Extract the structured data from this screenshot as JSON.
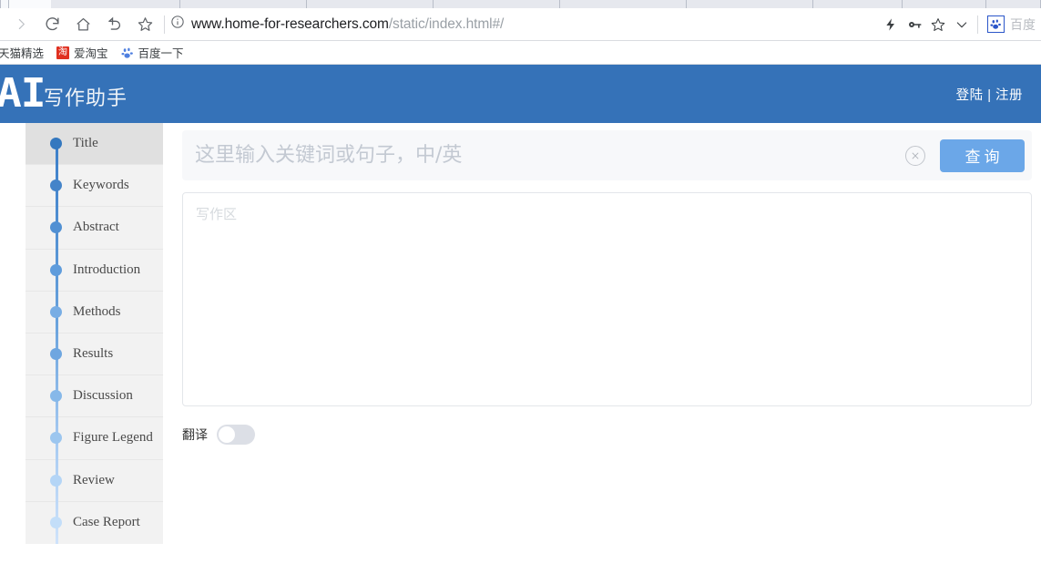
{
  "browser": {
    "nav_icons": [
      {
        "name": "forward-icon",
        "glyph": "forward"
      },
      {
        "name": "reload-icon",
        "glyph": "reload"
      },
      {
        "name": "home-icon",
        "glyph": "home"
      },
      {
        "name": "back-history-icon",
        "glyph": "undo"
      },
      {
        "name": "bookmark-star-icon",
        "glyph": "star"
      }
    ],
    "url": {
      "domain": "www.home-for-researchers.com",
      "path": "/static/index.html#/",
      "security_icon": "info-circle-icon"
    },
    "toolbar_right": [
      {
        "name": "lightning-icon",
        "glyph": "⚡"
      },
      {
        "name": "key-icon",
        "glyph": "key"
      },
      {
        "name": "star-outline-icon",
        "glyph": "star"
      },
      {
        "name": "chevron-down-icon",
        "glyph": "chevron"
      }
    ],
    "extension": {
      "name": "baidu-extension",
      "icon": "baidu-paw-icon",
      "label": "百度"
    },
    "bookmarks": [
      {
        "label": "天猫精选",
        "icon": "none"
      },
      {
        "label": "爱淘宝",
        "icon": "taobao-icon",
        "icon_glyph": "淘"
      },
      {
        "label": "百度一下",
        "icon": "baidu-paw-icon"
      }
    ],
    "tab_count": 11
  },
  "app_header": {
    "brand_mark": "AI",
    "brand_text": "写作助手",
    "auth": "登陆 | 注册",
    "bg_color": "#3572b8"
  },
  "sidebar": {
    "items": [
      {
        "label": "Title",
        "dot_color": "#3478bf",
        "active": true
      },
      {
        "label": "Keywords",
        "dot_color": "#4584c9",
        "active": false
      },
      {
        "label": "Abstract",
        "dot_color": "#5190d3",
        "active": false
      },
      {
        "label": "Introduction",
        "dot_color": "#5f9cdc",
        "active": false
      },
      {
        "label": "Methods",
        "dot_color": "#78ade4",
        "active": false
      },
      {
        "label": "Results",
        "dot_color": "#6ea6e0",
        "active": false
      },
      {
        "label": "Discussion",
        "dot_color": "#86b8e9",
        "active": false
      },
      {
        "label": "Figure Legend",
        "dot_color": "#9cc6ef",
        "active": false
      },
      {
        "label": "Review",
        "dot_color": "#b4d5f6",
        "active": false
      },
      {
        "label": "Case Report",
        "dot_color": "#c3def9",
        "active": false
      }
    ]
  },
  "main": {
    "search": {
      "value": "",
      "placeholder": "这里输入关键词或句子，中/英",
      "clear_icon": "clear-circle-icon",
      "button_label": "查询",
      "button_color": "#6ba7e8"
    },
    "editor": {
      "value": "",
      "placeholder": "写作区"
    },
    "translate": {
      "label": "翻译",
      "state": "off"
    }
  }
}
